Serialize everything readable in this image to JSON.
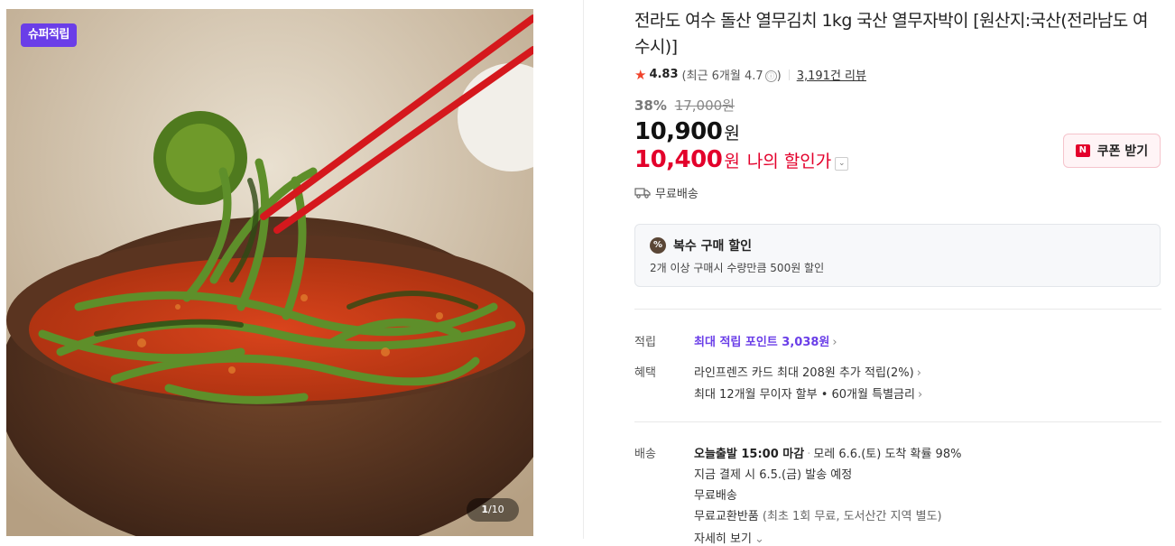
{
  "image": {
    "badge": "슈퍼적립",
    "counter_current": "1",
    "counter_total": "/10"
  },
  "product": {
    "title": "전라도 여수 돌산 열무김치 1kg 국산 열무자박이 [원산지:국산(전라남도 여수시)]",
    "rating": "4.83",
    "recent_rating": "(최근 6개월 4.7",
    "recent_close": ")",
    "info_icon": "ⓘ",
    "review_count": "3,191건 리뷰",
    "discount_rate": "38%",
    "original_price": "17,000원",
    "price": "10,900",
    "price_unit": "원",
    "my_price": "10,400",
    "my_price_unit": "원",
    "my_price_label": "나의 할인가",
    "coupon_label": "쿠폰 받기",
    "coupon_icon_text": "N",
    "free_shipping": "무료배송"
  },
  "multi_discount": {
    "title": "복수 구매 할인",
    "description": "2개 이상 구매시 수량만큼 500원 할인",
    "icon_text": "%"
  },
  "details": {
    "points_label": "적립",
    "points_value": "최대 적립 포인트 3,038원",
    "benefit_label": "혜택",
    "benefit_line1": "라인프렌즈 카드 최대 208원 추가 적립(2%)",
    "benefit_line2": "최대 12개월 무이자 할부 • 60개월 특별금리",
    "delivery_label": "배송",
    "delivery_today": "오늘출발 15:00 마감",
    "delivery_arrival": "모레 6.6.(토) 도착 확률 98%",
    "delivery_ship": "지금 결제 시 6.5.(금) 발송 예정",
    "delivery_free": "무료배송",
    "delivery_return": "무료교환반품",
    "delivery_return_note": "(최초 1회 무료, 도서산간 지역 별도)",
    "delivery_more": "자세히 보기"
  },
  "colors": {
    "accent_purple": "#6a3ee8",
    "price_red": "#e3002b",
    "star": "#f0432b"
  }
}
